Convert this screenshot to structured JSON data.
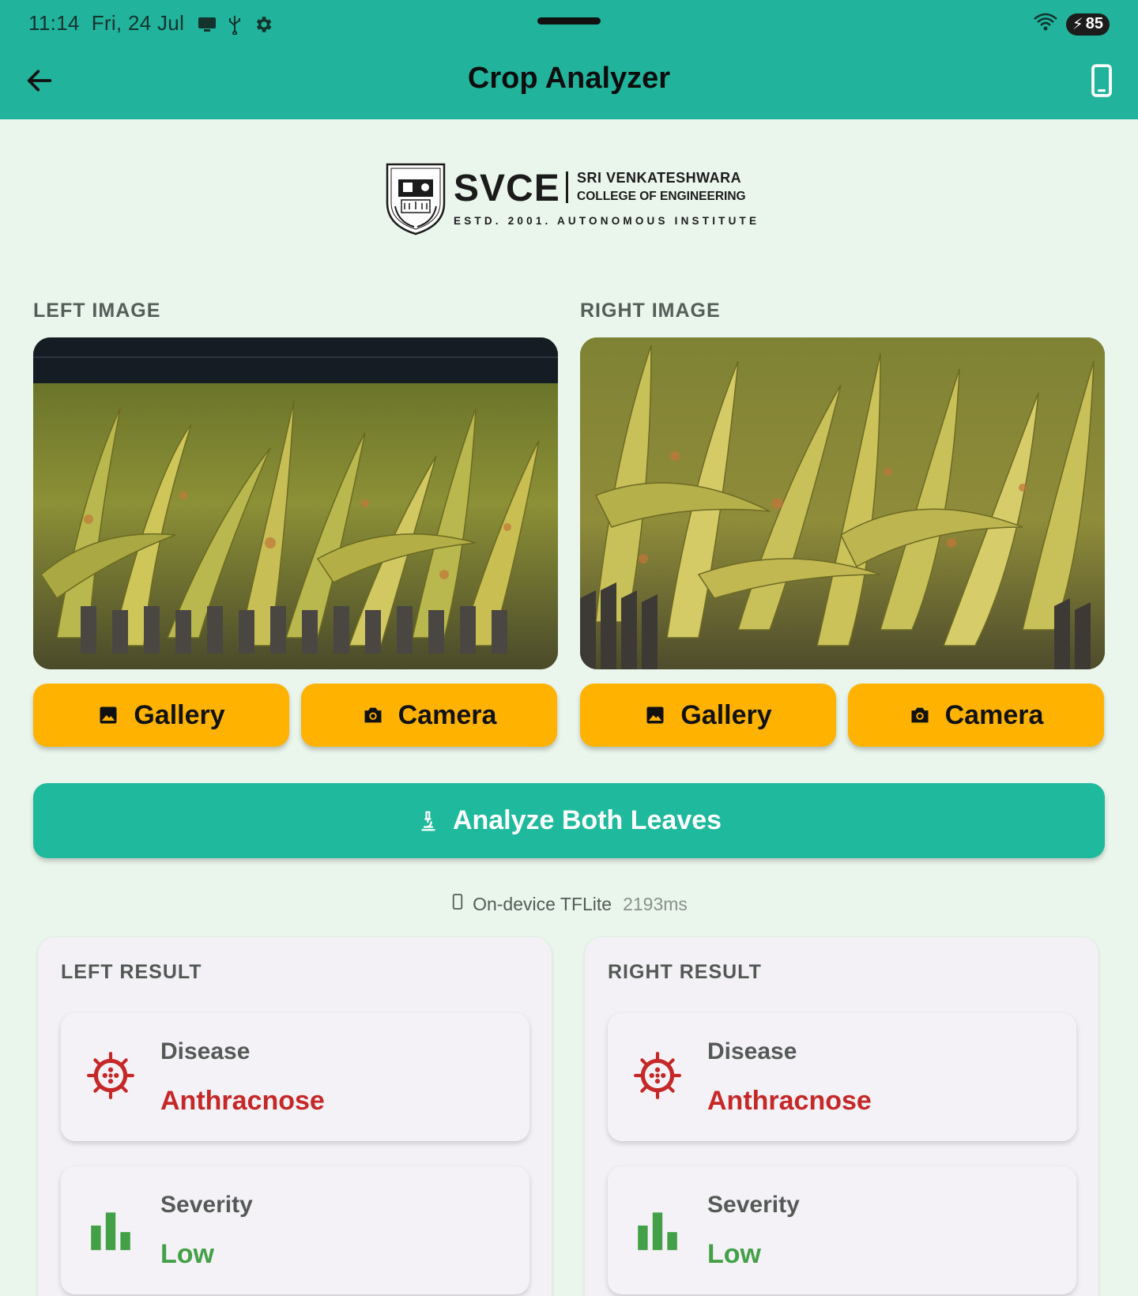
{
  "status_bar": {
    "time": "11:14",
    "date": "Fri, 24 Jul",
    "battery": "85"
  },
  "app_bar": {
    "title": "Crop Analyzer"
  },
  "logo": {
    "crest_text": "SVCE BENGALURU",
    "abbr": "SVCE",
    "line1": "SRI VENKATESHWARA",
    "line2": "COLLEGE OF ENGINEERING",
    "line3": "ESTD. 2001. AUTONOMOUS INSTITUTE"
  },
  "left_image": {
    "label": "LEFT IMAGE",
    "gallery_label": "Gallery",
    "camera_label": "Camera"
  },
  "right_image": {
    "label": "RIGHT IMAGE",
    "gallery_label": "Gallery",
    "camera_label": "Camera"
  },
  "analyze_button": {
    "label": "Analyze Both Leaves"
  },
  "engine_info": {
    "mode": "On-device TFLite",
    "time": "2193ms"
  },
  "left_result": {
    "title": "LEFT RESULT",
    "disease_label": "Disease",
    "disease_value": "Anthracnose",
    "severity_label": "Severity",
    "severity_value": "Low"
  },
  "right_result": {
    "title": "RIGHT RESULT",
    "disease_label": "Disease",
    "disease_value": "Anthracnose",
    "severity_label": "Severity",
    "severity_value": "Low"
  },
  "colors": {
    "app_bar": "#21b39b",
    "accent_button": "#ffb300",
    "primary_button": "#1fba9d",
    "disease": "#c62828",
    "severity_low": "#43a047"
  },
  "icons": [
    "back-arrow-icon",
    "phone-icon",
    "image-icon",
    "camera-icon",
    "microscope-icon",
    "virus-icon",
    "bar-chart-icon"
  ]
}
